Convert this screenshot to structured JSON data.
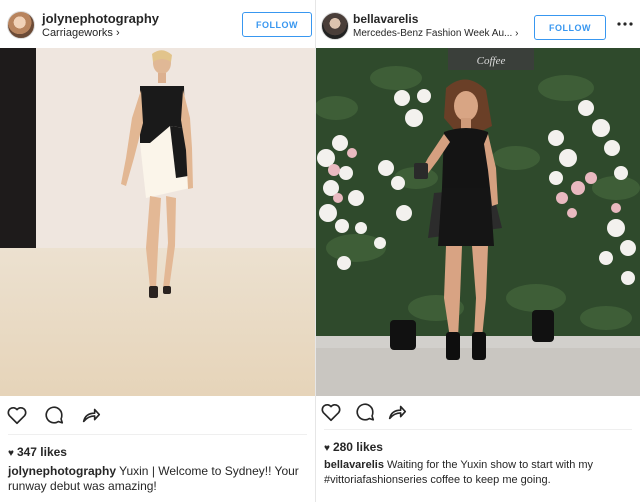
{
  "posts": [
    {
      "username": "jolynephotography",
      "location": "Carriageworks",
      "location_chevron": "›",
      "follow_label": "FOLLOW",
      "likes": "347 likes",
      "caption_user": "jolynephotography",
      "caption_text": "Yuxin | Welcome to Sydney!! Your runway debut was amazing!",
      "photo_icon": "runway-photo"
    },
    {
      "username": "bellavarelis",
      "location": "Mercedes-Benz Fashion Week Au...",
      "location_chevron": "›",
      "follow_label": "FOLLOW",
      "likes": "280 likes",
      "caption_user": "bellavarelis",
      "caption_text": "Waiting for the Yuxin show to start with my #vittoriafashionseries coffee to keep me going.",
      "photo_icon": "flower-wall-photo",
      "photo_sign_text": "Coffee"
    }
  ],
  "icons": [
    "heart-icon",
    "comment-icon",
    "share-icon",
    "more-icon"
  ],
  "colors": {
    "follow_blue": "#3897f0",
    "text": "#262626",
    "divider": "#efefef"
  }
}
